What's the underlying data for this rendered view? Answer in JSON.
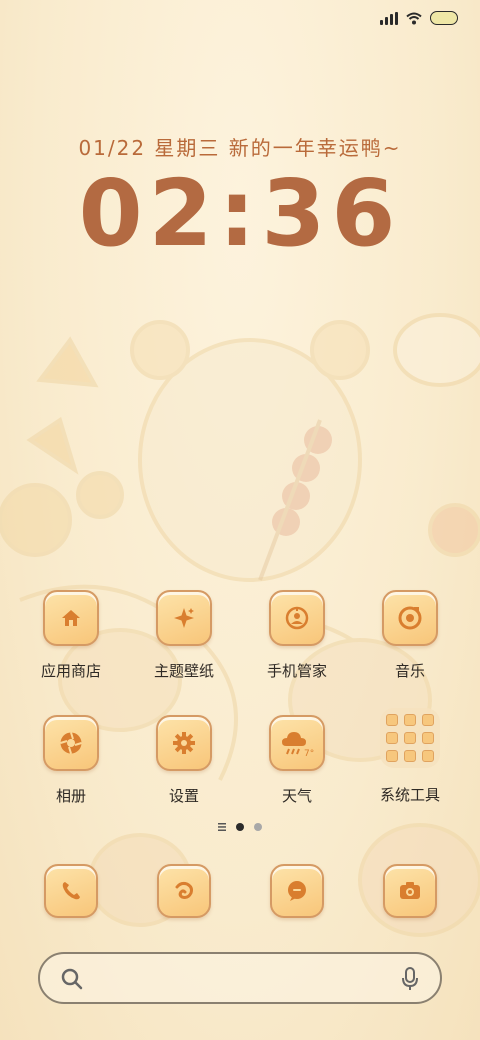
{
  "status_bar": {
    "signal_icon": "signal-bars-icon",
    "wifi_icon": "wifi-icon",
    "battery_icon": "battery-icon",
    "battery_color": "#efe7a6"
  },
  "lockinfo": {
    "date_text": "01/22  星期三 新的一年幸运鸭~",
    "time_text": "02:36",
    "date_color": "#b96a3a",
    "time_color": "#b36a42"
  },
  "apps": [
    {
      "label": "应用商店",
      "icon": "house-icon"
    },
    {
      "label": "主题壁纸",
      "icon": "sparkle-icon"
    },
    {
      "label": "手机管家",
      "icon": "shield-globe-icon"
    },
    {
      "label": "音乐",
      "icon": "music-disc-icon"
    },
    {
      "label": "相册",
      "icon": "aperture-icon"
    },
    {
      "label": "设置",
      "icon": "gear-icon"
    },
    {
      "label": "天气",
      "icon": "weather-cloud-icon",
      "badge": "7°"
    },
    {
      "label": "系统工具",
      "icon": "folder-icon"
    }
  ],
  "page_indicator": {
    "pages": 2,
    "active": 1,
    "icon": "list-lines-icon"
  },
  "dock": [
    {
      "name": "phone",
      "icon": "phone-icon"
    },
    {
      "name": "browser",
      "icon": "browser-swirl-icon"
    },
    {
      "name": "messages",
      "icon": "chat-bubble-icon"
    },
    {
      "name": "camera",
      "icon": "camera-icon"
    }
  ],
  "search": {
    "placeholder": "",
    "search_icon": "search-icon",
    "mic_icon": "microphone-icon"
  },
  "colors": {
    "background": "#fbf0d8",
    "icon_fill": "#f8c67a",
    "icon_border": "#d59a64",
    "glyph": "#d97e2f"
  }
}
